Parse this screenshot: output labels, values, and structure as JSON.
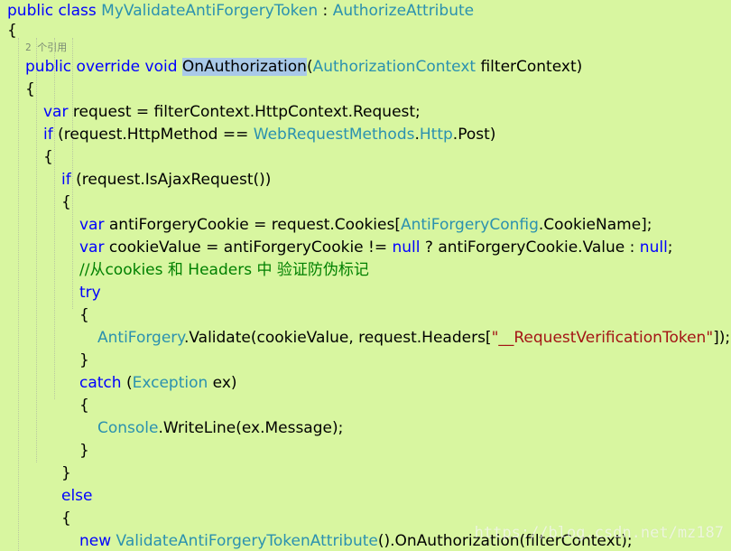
{
  "editor": {
    "code_lens": "2 个引用",
    "watermark": "https://blog.csdn.net/mz187",
    "lines": [
      [
        {
          "t": "public class ",
          "c": "kw"
        },
        {
          "t": "MyValidateAntiForgeryToken",
          "c": "ty"
        },
        {
          "t": " : ",
          "c": ""
        },
        {
          "t": "AuthorizeAttribute",
          "c": "ty"
        }
      ],
      [
        {
          "t": "{",
          "c": ""
        }
      ],
      [
        {
          "t": "public override void ",
          "c": "kw"
        },
        {
          "t": "OnAuthorization",
          "c": "sel"
        },
        {
          "t": "(",
          "c": ""
        },
        {
          "t": "AuthorizationContext",
          "c": "ty"
        },
        {
          "t": " filterContext)",
          "c": ""
        }
      ],
      [
        {
          "t": "{",
          "c": ""
        }
      ],
      [
        {
          "t": "var",
          "c": "kw"
        },
        {
          "t": " request = filterContext.HttpContext.Request;",
          "c": ""
        }
      ],
      [
        {
          "t": "if",
          "c": "kw"
        },
        {
          "t": " (request.HttpMethod == ",
          "c": ""
        },
        {
          "t": "WebRequestMethods",
          "c": "ty"
        },
        {
          "t": ".",
          "c": ""
        },
        {
          "t": "Http",
          "c": "ty"
        },
        {
          "t": ".Post)",
          "c": ""
        }
      ],
      [
        {
          "t": "{",
          "c": ""
        }
      ],
      [
        {
          "t": "if",
          "c": "kw"
        },
        {
          "t": " (request.IsAjaxRequest())",
          "c": ""
        }
      ],
      [
        {
          "t": "{",
          "c": ""
        }
      ],
      [
        {
          "t": "var",
          "c": "kw"
        },
        {
          "t": " antiForgeryCookie = request.Cookies[",
          "c": ""
        },
        {
          "t": "AntiForgeryConfig",
          "c": "ty"
        },
        {
          "t": ".CookieName];",
          "c": ""
        }
      ],
      [
        {
          "t": "var",
          "c": "kw"
        },
        {
          "t": " cookieValue = antiForgeryCookie != ",
          "c": ""
        },
        {
          "t": "null",
          "c": "kw"
        },
        {
          "t": " ? antiForgeryCookie.Value : ",
          "c": ""
        },
        {
          "t": "null",
          "c": "kw"
        },
        {
          "t": ";",
          "c": ""
        }
      ],
      [
        {
          "t": "//从cookies 和 Headers 中 验证防伪标记",
          "c": "cm"
        }
      ],
      [
        {
          "t": "try",
          "c": "kw"
        }
      ],
      [
        {
          "t": "{",
          "c": ""
        }
      ],
      [
        {
          "t": "AntiForgery",
          "c": "ty"
        },
        {
          "t": ".Validate(cookieValue, request.Headers[",
          "c": ""
        },
        {
          "t": "\"__RequestVerificationToken\"",
          "c": "st"
        },
        {
          "t": "]);",
          "c": ""
        }
      ],
      [
        {
          "t": "}",
          "c": ""
        }
      ],
      [
        {
          "t": "catch",
          "c": "kw"
        },
        {
          "t": " (",
          "c": ""
        },
        {
          "t": "Exception",
          "c": "ty"
        },
        {
          "t": " ex)",
          "c": ""
        }
      ],
      [
        {
          "t": "{",
          "c": ""
        }
      ],
      [
        {
          "t": "Console",
          "c": "ty"
        },
        {
          "t": ".WriteLine(ex.Message);",
          "c": ""
        }
      ],
      [
        {
          "t": "}",
          "c": ""
        }
      ],
      [
        {
          "t": "}",
          "c": ""
        }
      ],
      [
        {
          "t": "else",
          "c": "kw"
        }
      ],
      [
        {
          "t": "{",
          "c": ""
        }
      ],
      [
        {
          "t": "new ",
          "c": "kw"
        },
        {
          "t": "ValidateAntiForgeryTokenAttribute",
          "c": "ty"
        },
        {
          "t": "().OnAuthorization(filterContext);",
          "c": ""
        }
      ]
    ]
  },
  "colors": {
    "background": "#d8f6a0",
    "keyword": "#0000ff",
    "type": "#2b91af",
    "comment": "#008000",
    "string": "#a31515",
    "selection": "#a9c9e8"
  }
}
